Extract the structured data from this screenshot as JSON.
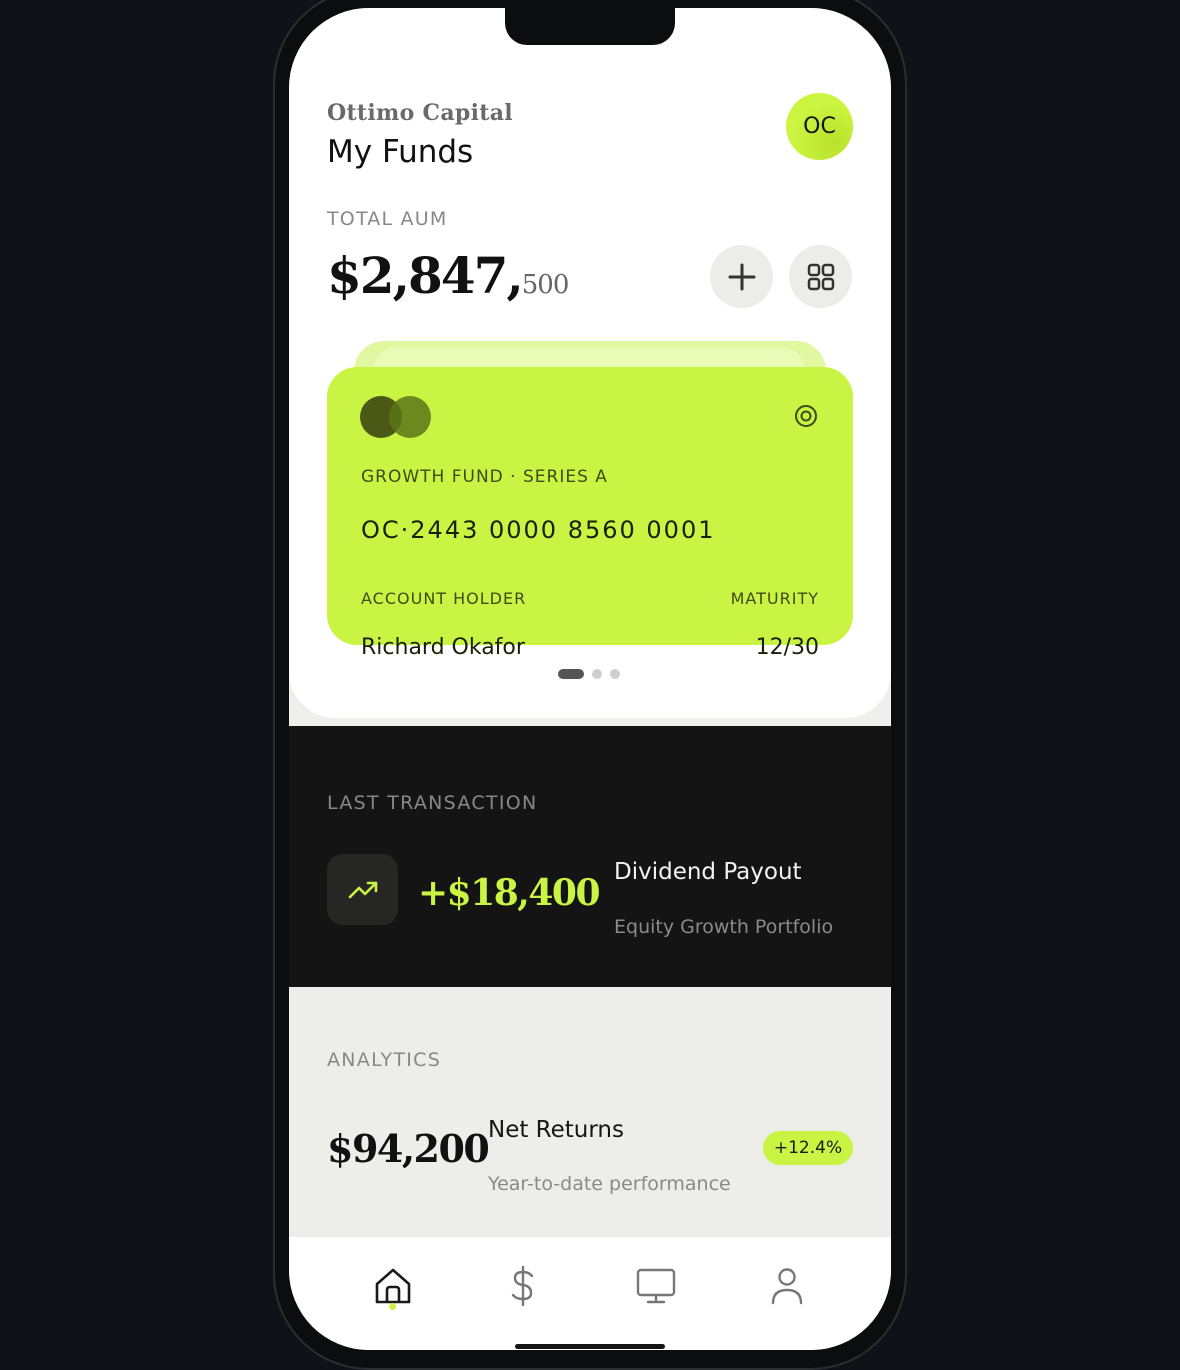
{
  "header": {
    "brand": "Ottimo Capital",
    "title": "My Funds",
    "avatar_initials": "OC"
  },
  "aum": {
    "label": "TOTAL AUM",
    "value_main": "$2,847,",
    "value_cents": "500"
  },
  "actions": [
    {
      "icon": "plus-icon"
    },
    {
      "icon": "grid-icon"
    }
  ],
  "card": {
    "logo": "interlocking-circles-logo",
    "fund_name": "GROWTH FUND · SERIES A",
    "number": "OC·2443 0000 8560 0001",
    "holder_label": "ACCOUNT HOLDER",
    "holder_name": "Richard Okafor",
    "maturity_label": "MATURITY",
    "maturity_value": "12/30",
    "contactless_icon": "concentric-circle-icon"
  },
  "carousel": {
    "total": 3,
    "active": 1
  },
  "last_transaction": {
    "label": "LAST TRANSACTION",
    "amount": "+$18,400",
    "title": "Dividend Payout",
    "subtitle": "Equity Growth Portfolio",
    "icon": "trend-up-icon"
  },
  "analytics": {
    "label": "ANALYTICS",
    "value": "$94,200",
    "title": "Net Returns",
    "subtitle": "Year-to-date performance",
    "badge": "+12.4%"
  },
  "nav": [
    {
      "icon": "home-icon",
      "active": true
    },
    {
      "icon": "dollar-icon",
      "active": false
    },
    {
      "icon": "monitor-icon",
      "active": false
    },
    {
      "icon": "user-icon",
      "active": false
    }
  ],
  "colors": {
    "accent": "#c9f443",
    "dark": "#141414",
    "background": "#0f1217"
  }
}
